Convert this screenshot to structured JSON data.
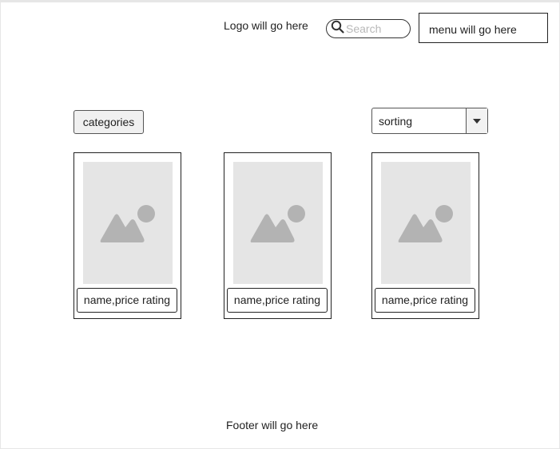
{
  "header": {
    "logo_text": "Logo will go here",
    "search_placeholder": "Search",
    "menu_text": "menu will go here"
  },
  "toolbar": {
    "categories_label": "categories",
    "sorting_value": "sorting"
  },
  "products": [
    {
      "label": "name,price rating",
      "image_icon": "image-placeholder-icon"
    },
    {
      "label": "name,price rating",
      "image_icon": "image-placeholder-icon"
    },
    {
      "label": "name,price rating",
      "image_icon": "image-placeholder-icon"
    }
  ],
  "footer": {
    "text": "Footer will go here"
  },
  "colors": {
    "placeholder_bg": "#e5e5e5",
    "placeholder_icon": "#b3b3b3",
    "border": "#222222"
  }
}
